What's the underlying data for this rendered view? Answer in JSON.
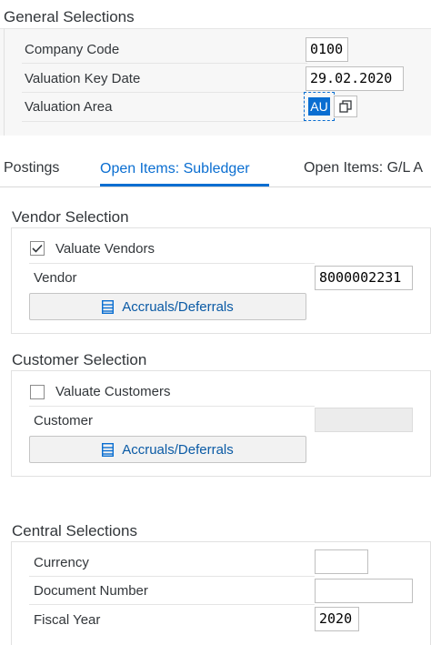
{
  "general": {
    "title": "General Selections",
    "company_code_label": "Company Code",
    "company_code_value": "0100",
    "valuation_key_date_label": "Valuation Key Date",
    "valuation_key_date_value": "29.02.2020",
    "valuation_area_label": "Valuation Area",
    "valuation_area_value": "AU"
  },
  "tabs": [
    {
      "label": "Postings",
      "active": false
    },
    {
      "label": "Open Items: Subledger",
      "active": true
    },
    {
      "label": "Open Items: G/L A",
      "active": false
    }
  ],
  "vendor": {
    "title": "Vendor Selection",
    "valuate_label": "Valuate Vendors",
    "valuate_checked": true,
    "vendor_label": "Vendor",
    "vendor_value": "8000002231",
    "accruals_label": "Accruals/Deferrals"
  },
  "customer": {
    "title": "Customer Selection",
    "valuate_label": "Valuate Customers",
    "valuate_checked": false,
    "customer_label": "Customer",
    "customer_value": "",
    "accruals_label": "Accruals/Deferrals"
  },
  "central": {
    "title": "Central Selections",
    "currency_label": "Currency",
    "currency_value": "",
    "document_number_label": "Document Number",
    "document_number_value": "",
    "fiscal_year_label": "Fiscal Year",
    "fiscal_year_value": "2020"
  },
  "icons": {
    "list": "list-icon",
    "value_help": "value-help-icon",
    "checkmark": "checkmark-icon"
  },
  "colors": {
    "accent": "#0a6ed1",
    "selected_bg": "#0a6ed1"
  }
}
